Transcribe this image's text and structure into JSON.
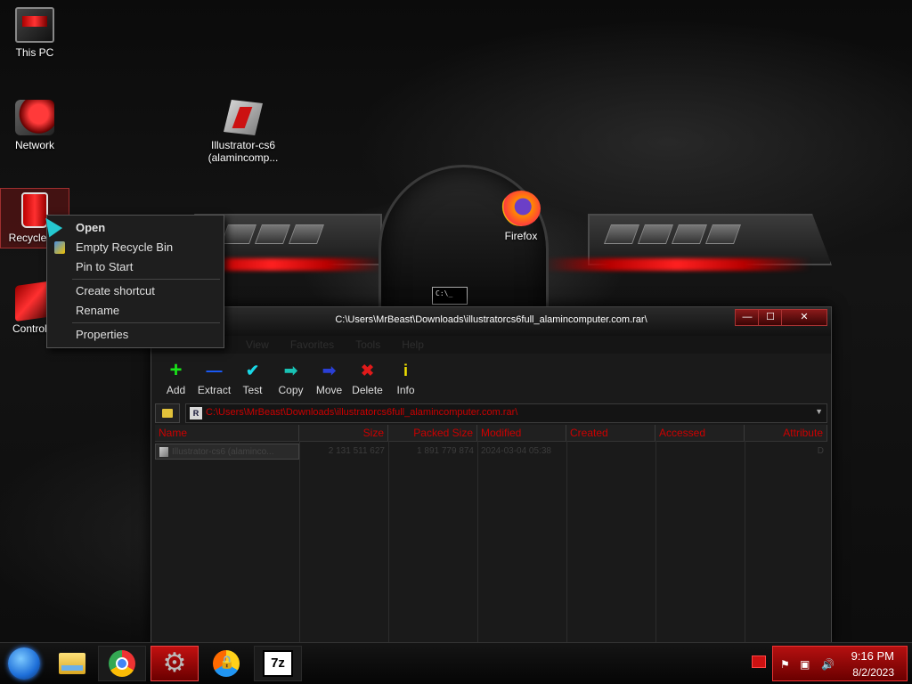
{
  "desktop": {
    "icons": [
      {
        "label": "This PC"
      },
      {
        "label": "Network"
      },
      {
        "label": "Recycle"
      },
      {
        "label": "Control P"
      },
      {
        "label": "Illustrator-cs6 (alamincomp..."
      },
      {
        "label": "Firefox"
      }
    ],
    "cmd_text": "C:\\_"
  },
  "context_menu": {
    "items": [
      {
        "label": "Open",
        "bold": true
      },
      {
        "label": "Empty Recycle Bin",
        "icon": "shield-icon"
      },
      {
        "label": "Pin to Start"
      },
      {
        "label": "Create shortcut"
      },
      {
        "label": "Rename"
      },
      {
        "label": "Properties"
      }
    ]
  },
  "archive_window": {
    "title": "C:\\Users\\MrBeast\\Downloads\\illustratorcs6full_alamincomputer.com.rar\\",
    "buttons": {
      "minimize": "—",
      "maximize": "☐",
      "close": "✕"
    },
    "menu": [
      "File",
      "Edit",
      "View",
      "Favorites",
      "Tools",
      "Help"
    ],
    "toolbar": [
      {
        "label": "Add",
        "icon": "add-icon",
        "color": "#19e619",
        "glyph": "+"
      },
      {
        "label": "Extract",
        "icon": "extract-icon",
        "color": "#1a5cff",
        "glyph": "—"
      },
      {
        "label": "Test",
        "icon": "test-icon",
        "color": "#19d7e6",
        "glyph": "✔"
      },
      {
        "label": "Copy",
        "icon": "copy-icon",
        "color": "#19c2b4",
        "glyph": "➡"
      },
      {
        "label": "Move",
        "icon": "move-icon",
        "color": "#2a3fd6",
        "glyph": "➡"
      },
      {
        "label": "Delete",
        "icon": "delete-icon",
        "color": "#e01a1a",
        "glyph": "✖"
      },
      {
        "label": "Info",
        "icon": "info-icon",
        "color": "#f0e000",
        "glyph": "i"
      }
    ],
    "address": "C:\\Users\\MrBeast\\Downloads\\illustratorcs6full_alamincomputer.com.rar\\",
    "columns": [
      "Name",
      "Size",
      "Packed Size",
      "Modified",
      "Created",
      "Accessed",
      "Attribute"
    ],
    "rows": [
      {
        "name": "Illustrator-cs6 (alaminco...",
        "size": "2 131 511 627",
        "packed": "1 891 779 874",
        "modified": "2024-03-04 05:38",
        "created": "",
        "accessed": "",
        "attr": "D"
      }
    ]
  },
  "taskbar": {
    "apps": [
      "start-orb",
      "file-explorer",
      "chrome",
      "settings",
      "vpn",
      "7-zip"
    ],
    "clock": {
      "time": "9:16 PM",
      "date": "8/2/2023"
    }
  },
  "colors": {
    "accent": "#c21010",
    "header_text": "#cc0000"
  }
}
